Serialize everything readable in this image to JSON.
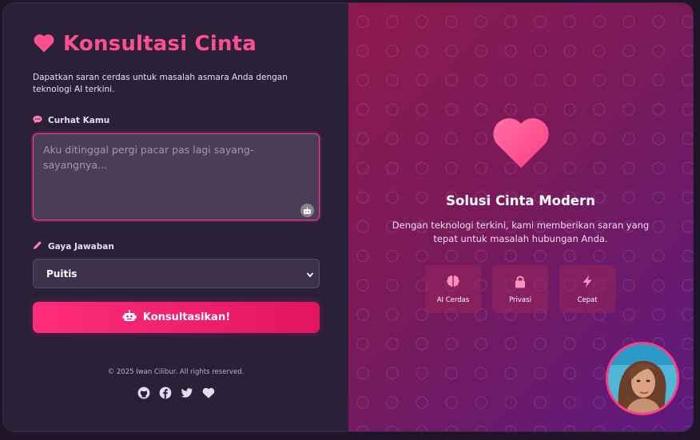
{
  "app": {
    "title": "Konsultasi Cinta",
    "description": "Dapatkan saran cerdas untuk masalah asmara Anda dengan teknologi AI terkini."
  },
  "form": {
    "message_label": "Curhat Kamu",
    "message_placeholder": "Aku ditinggal pergi pacar pas lagi sayang-sayangnya...",
    "style_label": "Gaya Jawaban",
    "style_selected": "Puitis",
    "submit_label": "Konsultasikan!"
  },
  "footer": {
    "copyright": "© 2025 Iwan Cilibur. All rights reserved.",
    "socials": [
      "github-icon",
      "facebook-icon",
      "twitter-icon",
      "heart-icon"
    ]
  },
  "hero": {
    "title": "Solusi Cinta Modern",
    "description": "Dengan teknologi terkini, kami memberikan saran yang tepat untuk masalah hubungan Anda.",
    "features": [
      {
        "icon": "brain-icon",
        "label": "AI Cerdas"
      },
      {
        "icon": "lock-icon",
        "label": "Privasi"
      },
      {
        "icon": "bolt-icon",
        "label": "Cepat"
      }
    ]
  },
  "colors": {
    "accent": "#ff4f8f",
    "button": "#ff2d7a",
    "panel": "#2a2038"
  }
}
